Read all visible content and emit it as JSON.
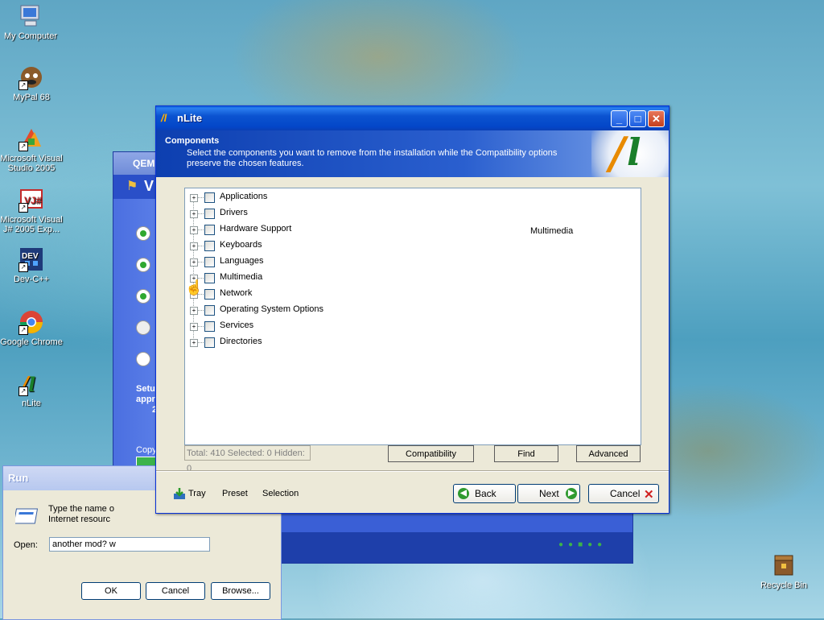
{
  "desktop": {
    "icons": [
      {
        "label": "My Computer",
        "icon": "my-computer-icon"
      },
      {
        "label": "MyPal 68",
        "icon": "mypal-icon"
      },
      {
        "label": "Microsoft Visual Studio 2005",
        "icon": "visual-studio-icon"
      },
      {
        "label": "Microsoft Visual J# 2005 Exp...",
        "icon": "visual-jsharp-icon"
      },
      {
        "label": "Dev-C++",
        "icon": "devcpp-icon"
      },
      {
        "label": "Google Chrome",
        "icon": "chrome-icon"
      },
      {
        "label": "nLite",
        "icon": "nlite-icon"
      },
      {
        "label": "Recycle Bin",
        "icon": "recycle-bin-icon"
      }
    ]
  },
  "qemu_window": {
    "title": "QEM",
    "banner_text": "V",
    "side_text": [
      "Setu",
      "appr",
      "2"
    ],
    "copy_label": "Copy"
  },
  "run_dialog": {
    "title": "Run",
    "description": "Type the name o\nInternet resourc",
    "open_label": "Open:",
    "open_value": "another mod? w",
    "ok_label": "OK",
    "cancel_label": "Cancel",
    "browse_label": "Browse..."
  },
  "nlite": {
    "title": "nLite",
    "header_title": "Components",
    "header_desc": "Select the components you want to remove from the installation while the Compatibility options preserve the chosen features.",
    "tree_items": [
      "Applications",
      "Drivers",
      "Hardware Support",
      "Keyboards",
      "Languages",
      "Multimedia",
      "Network",
      "Operating System Options",
      "Services",
      "Directories"
    ],
    "detail_text": "Multimedia",
    "status_text": "Total: 410 Selected: 0 Hidden: 0",
    "compatibility_label": "Compatibility",
    "find_label": "Find",
    "advanced_label": "Advanced",
    "tray_label": "Tray",
    "preset_label": "Preset",
    "selection_label": "Selection",
    "back_label": "Back",
    "next_label": "Next",
    "cancel_label": "Cancel"
  }
}
